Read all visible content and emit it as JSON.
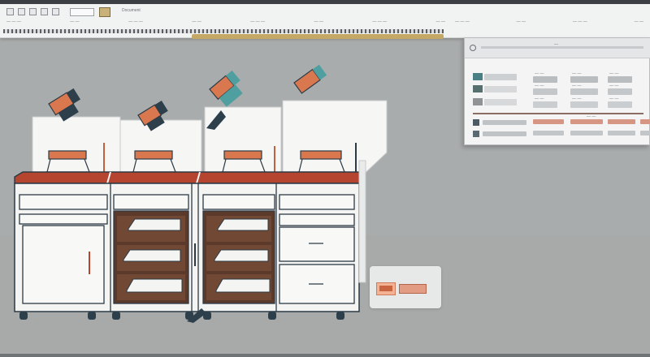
{
  "toolbar": {
    "title_text": "Document",
    "search_value": "",
    "labels": [
      "— — —",
      "— —",
      "— — —",
      "— —",
      "— — —",
      "— —",
      "— — —",
      "— —",
      "— — —",
      "— —",
      "— — —",
      "— —"
    ]
  },
  "panel": {
    "header_text": "—",
    "rows": [
      {
        "color": "#4a7f86",
        "value_a": "— —",
        "value_b": "— —",
        "value_c": "— —"
      },
      {
        "color": "#55706f",
        "value_a": "— —",
        "value_b": "— —",
        "value_c": "— —"
      },
      {
        "color": "#8f9396",
        "value_a": "— —",
        "value_b": "— —",
        "value_c": "— —"
      },
      {
        "color": "#4a5b66",
        "value_a": "— —",
        "value_b": "— —",
        "value_c": "— —"
      },
      {
        "color": "#5a6a73",
        "value_a": "— —",
        "value_b": "— —",
        "value_c": "— —"
      }
    ]
  },
  "colors": {
    "counter_top": "#b5452e",
    "cabinet": "#f4f4f2",
    "outline": "#2c3a45",
    "accent_teal": "#4f9fa1",
    "accent_orange": "#d9784f",
    "drawer_shadow": "#5b3a2c"
  },
  "icons": [
    "menu-grid-icon",
    "folder-icon",
    "image-icon",
    "settings-icon"
  ]
}
